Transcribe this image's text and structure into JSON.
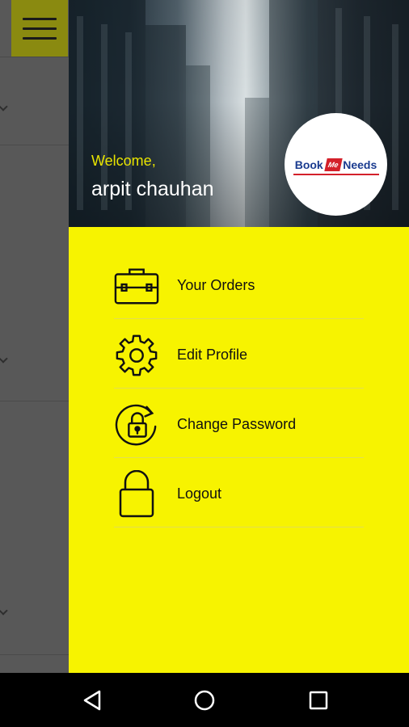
{
  "header": {
    "welcome": "Welcome,",
    "username": "arpit chauhan",
    "logo": {
      "part1": "Book",
      "part2": "Me",
      "part3": "Needs"
    }
  },
  "menu": {
    "items": [
      {
        "label": "Your Orders",
        "icon": "briefcase-icon"
      },
      {
        "label": "Edit Profile",
        "icon": "gear-icon"
      },
      {
        "label": "Change Password",
        "icon": "lock-refresh-icon"
      },
      {
        "label": "Logout",
        "icon": "lock-icon"
      }
    ]
  },
  "colors": {
    "drawer": "#f7f300",
    "accent_text": "#e9e400"
  },
  "navbar": {
    "back": "back-icon",
    "home": "home-icon",
    "recents": "recents-icon"
  }
}
